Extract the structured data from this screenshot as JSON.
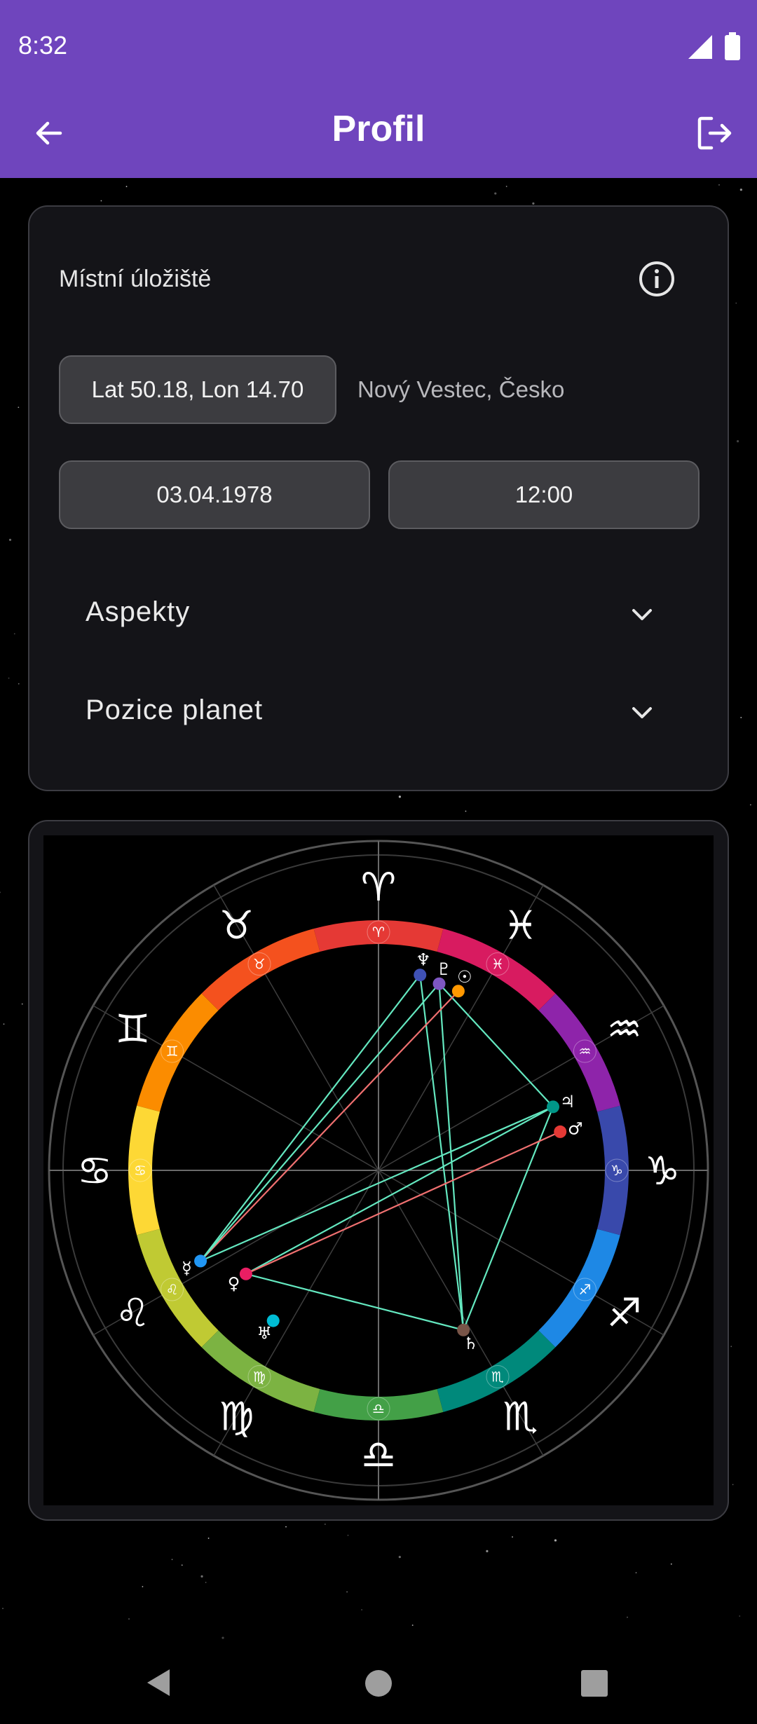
{
  "status_bar": {
    "time": "8:32"
  },
  "app_bar": {
    "title": "Profil"
  },
  "settings": {
    "storage_label": "Místní úložiště",
    "coordinates": "Lat 50.18, Lon 14.70",
    "place": "Nový Vestec, Česko",
    "date": "03.04.1978",
    "time": "12:00",
    "aspects_label": "Aspekty",
    "planet_positions_label": "Pozice planet"
  },
  "chart": {
    "zodiac_signs": [
      "♈",
      "♉",
      "♊",
      "♋",
      "♌",
      "♍",
      "♎",
      "♏",
      "♐",
      "♑",
      "♒",
      "♓"
    ],
    "sign_colors": [
      "#e53935",
      "#f4511e",
      "#fb8c00",
      "#fdd835",
      "#c0ca33",
      "#7cb342",
      "#43a047",
      "#00897b",
      "#1e88e5",
      "#3949ab",
      "#8e24aa",
      "#d81b60"
    ],
    "planets": [
      {
        "symbol": "♆",
        "color": "#3f51b5"
      },
      {
        "symbol": "♇",
        "color": "#7e57c2"
      },
      {
        "symbol": "☉",
        "color": "#ff9800"
      },
      {
        "symbol": "♃",
        "color": "#009688"
      },
      {
        "symbol": "♂",
        "color": "#e53935"
      },
      {
        "symbol": "☿",
        "color": "#2196f3"
      },
      {
        "symbol": "♀",
        "color": "#e91e63"
      },
      {
        "symbol": "♅",
        "color": "#00bcd4"
      },
      {
        "symbol": "♄",
        "color": "#795548"
      }
    ],
    "aspect_colors": {
      "harmonic": "#64e8c0",
      "tense": "#f07070"
    }
  }
}
